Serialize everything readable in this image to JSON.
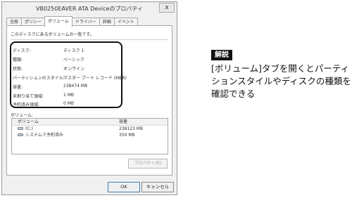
{
  "window": {
    "title": "VB0250EAVER ATA Deviceのプロパティ",
    "close_label": "x"
  },
  "tabs": [
    {
      "label": "全般"
    },
    {
      "label": "ポリシー"
    },
    {
      "label": "ボリューム"
    },
    {
      "label": "ドライバー"
    },
    {
      "label": "詳細"
    },
    {
      "label": "イベント"
    }
  ],
  "panel": {
    "description": "このディスクにあるボリュームの一覧です。"
  },
  "disk_info": [
    {
      "label": "ディスク:",
      "value": "ディスク 1"
    },
    {
      "label": "種類:",
      "value": "ベーシック"
    },
    {
      "label": "状態:",
      "value": "オンライン"
    },
    {
      "label": "パーティションのスタイル:",
      "value": "マスター ブート レコード (MBR)"
    },
    {
      "label": "容量:",
      "value": "238474 MB"
    },
    {
      "label": "未割り当て領域:",
      "value": "1 MB"
    },
    {
      "label": "予約済み領域:",
      "value": "0 MB"
    }
  ],
  "volumes": {
    "label": "ボリューム:",
    "columns": [
      "ボリューム",
      "容量"
    ],
    "rows": [
      {
        "name": "(C:)",
        "capacity": "238123 MB",
        "icon": "drive-icon"
      },
      {
        "name": "システムで予約済み",
        "capacity": "350 MB",
        "icon": "drive-icon"
      }
    ],
    "properties_button": "プロパティ(R)"
  },
  "buttons": {
    "ok": "OK",
    "cancel": "キャンセル"
  },
  "callout": {
    "badge": "解説",
    "text": "[ボリューム]タブを開くとパーティションスタイルやディスクの種類を確認できる"
  }
}
